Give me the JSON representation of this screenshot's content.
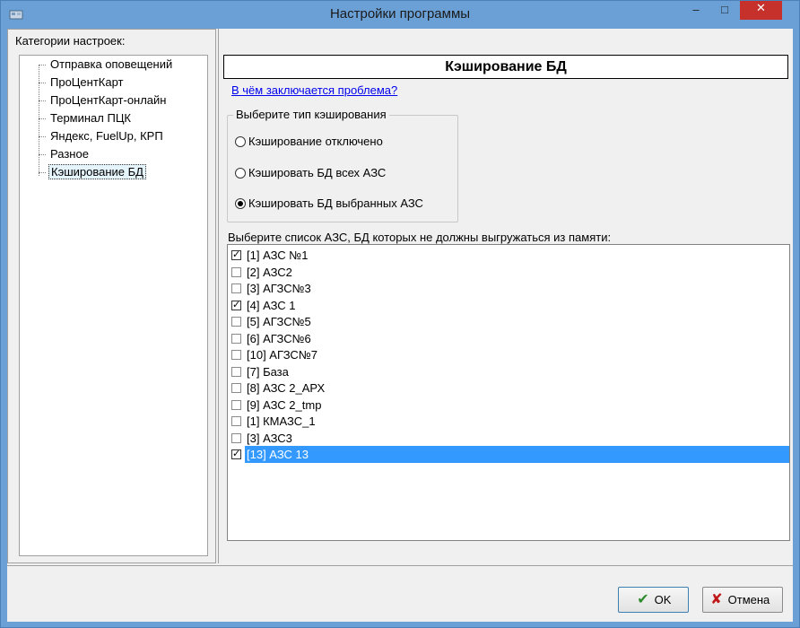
{
  "window": {
    "title": "Настройки программы",
    "minimize_glyph": "–",
    "maximize_glyph": "□",
    "close_glyph": "✕"
  },
  "left_panel": {
    "label": "Категории настроек:",
    "items": [
      {
        "label": "Отправка оповещений"
      },
      {
        "label": "ПроЦентКарт"
      },
      {
        "label": "ПроЦентКарт-онлайн"
      },
      {
        "label": "Терминал ПЦК"
      },
      {
        "label": "Яндекс, FuelUp, КРП"
      },
      {
        "label": "Разное"
      },
      {
        "label": "Кэширование БД",
        "selected": true
      }
    ]
  },
  "main": {
    "header": "Кэширование БД",
    "help_link": "В чём заключается проблема?",
    "group_title": "Выберите тип кэширования",
    "radio_options": [
      {
        "label": "Кэширование отключено"
      },
      {
        "label": "Кэшировать БД всех АЗС"
      },
      {
        "label": "Кэшировать БД выбранных АЗС"
      }
    ],
    "selected_index": 2,
    "list_label": "Выберите список АЗС, БД которых не должны выгружаться из памяти:",
    "stations": [
      {
        "label": "[1] АЗС №1",
        "checked": true
      },
      {
        "label": "[2] АЗС2",
        "checked": false
      },
      {
        "label": "[3] АГЗС№3",
        "checked": false
      },
      {
        "label": "[4] АЗС 1",
        "checked": true
      },
      {
        "label": "[5] АГЗС№5",
        "checked": false
      },
      {
        "label": "[6] АГЗС№6",
        "checked": false
      },
      {
        "label": "[10] АГЗС№7",
        "checked": false
      },
      {
        "label": "[7] База",
        "checked": false
      },
      {
        "label": "[8] АЗС 2_АРХ",
        "checked": false
      },
      {
        "label": "[9] АЗС 2_tmp",
        "checked": false
      },
      {
        "label": "[1] КМАЗС_1",
        "checked": false
      },
      {
        "label": "[3] АЗС3",
        "checked": false
      },
      {
        "label": "[13] АЗС 13",
        "checked": true,
        "selected": true
      }
    ]
  },
  "buttons": {
    "ok": "OK",
    "cancel": "Отмена"
  },
  "icons": {
    "app": "app-icon",
    "ok": "checkmark-icon",
    "cancel": "cross-icon"
  },
  "colors": {
    "titlebar": "#6ba0d6",
    "close_button": "#c7312b",
    "selection": "#3399ff",
    "link": "#0000ee"
  }
}
